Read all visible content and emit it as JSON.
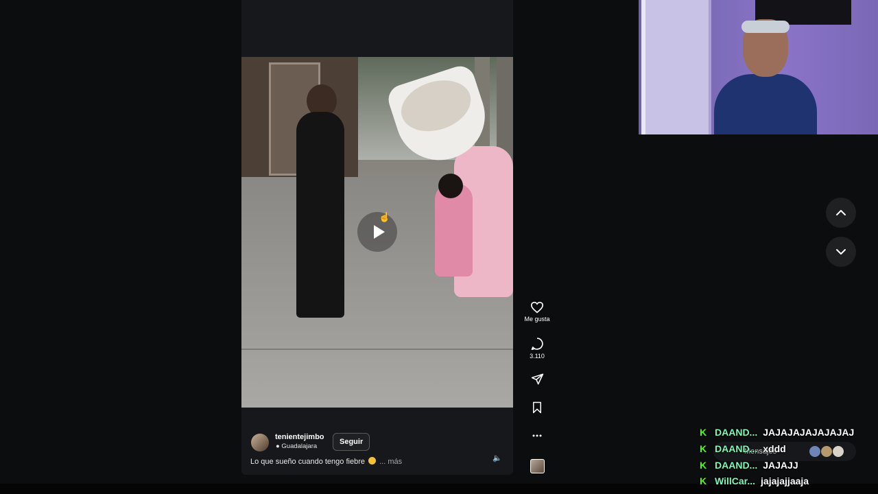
{
  "post": {
    "username": "tenientejimbo",
    "location": "Guadalajara",
    "follow_label": "Seguir",
    "caption": "Lo que sueño cuando tengo fiebre",
    "more_label": "... más"
  },
  "actions": {
    "like_label": "Me gusta",
    "comment_count": "3.110"
  },
  "messages_bar": {
    "label": "Mensajes"
  },
  "chat": [
    {
      "user": "DAAND...",
      "text": "JAJAJAJAJAJAJAJ"
    },
    {
      "user": "DAAND...",
      "text": "xddd"
    },
    {
      "user": "DAAND...",
      "text": "JAJAJJ"
    },
    {
      "user": "WillCar...",
      "text": "jajajajjaaja"
    }
  ],
  "colors": {
    "chat_badge": "#53fc18",
    "chat_user": "#7ef9b8",
    "background": "#0c0d0f"
  }
}
